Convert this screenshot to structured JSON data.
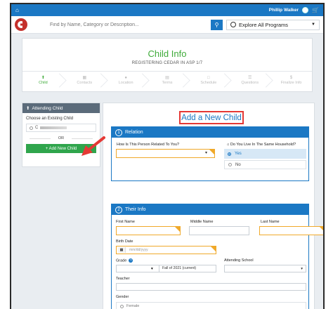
{
  "topbar": {
    "home_icon": "home-icon",
    "user_name": "Phillip Walker",
    "cart_icon": "cart-icon"
  },
  "search": {
    "placeholder": "Find by Name, Category or Description...",
    "explore_label": "Explore All Programs"
  },
  "header": {
    "title": "Child Info",
    "subtitle": "REGISTERING CEDAR IN ASP 1/7",
    "steps": [
      {
        "label": "Child"
      },
      {
        "label": "Contacts"
      },
      {
        "label": "Location"
      },
      {
        "label": "Terms"
      },
      {
        "label": "Schedule"
      },
      {
        "label": "Questions"
      },
      {
        "label": "Finalize Info"
      }
    ]
  },
  "sidebar": {
    "header": "Attending Child",
    "choose_label": "Choose an Existing Child",
    "existing_child_initial": "C",
    "or_label": "OR",
    "add_button": "+ Add New Child"
  },
  "main": {
    "title": "Add a New Child",
    "relation": {
      "step_num": "1",
      "heading": "Relation",
      "question": "How Is This Person Related To You?",
      "household_question": "Do You Live In The Same Household?",
      "options": [
        "Yes",
        "No"
      ],
      "selected": "Yes"
    },
    "their_info": {
      "step_num": "2",
      "heading": "Their Info",
      "first_name": "First Name",
      "middle_name": "Middle Name",
      "last_name": "Last Name",
      "birth_date": "Birth Date",
      "birth_placeholder": "mm/dd/yyyy",
      "grade": "Grade",
      "grade_term": "Fall of 2021 (current)",
      "attending_school": "Attending School",
      "teacher": "Teacher",
      "gender": "Gender",
      "gender_option": "Female"
    }
  },
  "colors": {
    "primary": "#1b78c4",
    "success": "#3fab3a",
    "button_green": "#2fa54c",
    "highlight": "#e53935",
    "required": "#f0a92a"
  }
}
